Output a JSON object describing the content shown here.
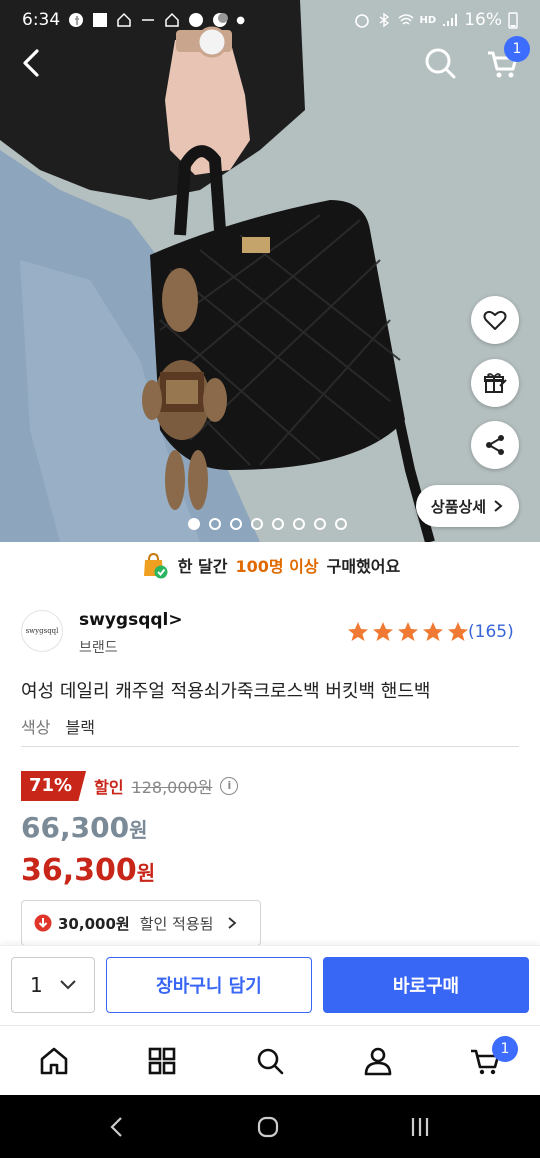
{
  "status_bar": {
    "time": "6:34",
    "battery": "16%",
    "network": "HD"
  },
  "hero": {
    "image_count": 8,
    "active_index": 0,
    "detail_button_label": "상품상세",
    "cart_badge": "1"
  },
  "banner": {
    "prefix": "한 달간",
    "highlight": "100명 이상",
    "suffix": "구매했어요"
  },
  "brand": {
    "logo_text": "swygsqql",
    "name": "swygsqql>",
    "sub": "브랜드",
    "rating": 5,
    "review_count": "(165)"
  },
  "product": {
    "title": "여성 데일리 캐주얼 적용쇠가죽크로스백 버킷백 핸드백",
    "option_label": "색상",
    "option_value": "블랙"
  },
  "price": {
    "discount_pct": "71%",
    "discount_label": "할인",
    "original": "128,000원",
    "price_before_coupon": "66,300",
    "final": "36,300",
    "won": "원",
    "coupon_amount": "30,000원",
    "coupon_text": "할인 적용됨"
  },
  "actions": {
    "quantity": "1",
    "add_to_cart": "장바구니 담기",
    "buy_now": "바로구매"
  },
  "tab_bar": {
    "cart_badge": "1",
    "tabs": [
      "home-icon",
      "category-icon",
      "search-icon",
      "profile-icon",
      "cart-icon"
    ]
  },
  "colors": {
    "accent_blue": "#3866f5",
    "sale_red": "#c9261a",
    "banner_orange": "#e06a00",
    "star": "#f07a33"
  }
}
